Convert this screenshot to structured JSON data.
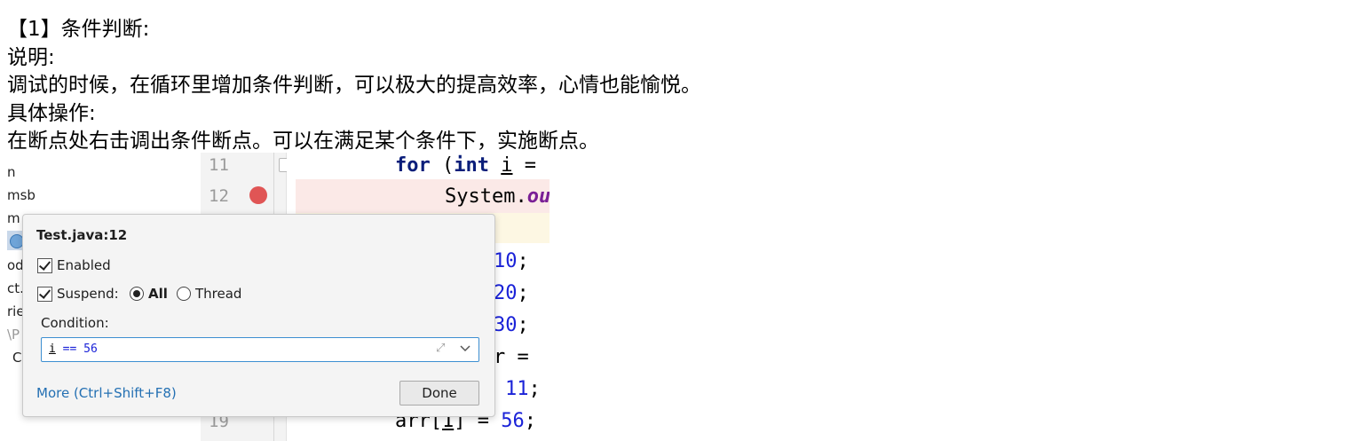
{
  "article": {
    "heading": "【1】条件判断:",
    "explain_label": "说明:",
    "explain_text": "调试的时候，在循环里增加条件判断，可以极大的提高效率，心情也能愉悦。",
    "steps_label": "具体操作:",
    "steps_text": "在断点处右击调出条件断点。可以在满足某个条件下，实施断点。"
  },
  "project_tree": {
    "items": [
      "n",
      "msb",
      "m",
      "od",
      "ct.i",
      "rie",
      "\\P",
      "C"
    ]
  },
  "gutter": {
    "line_numbers": [
      "11",
      "12",
      "19"
    ]
  },
  "code": {
    "line11": {
      "kw1": "for",
      "p1": " (",
      "kw2": "int",
      "sp": " ",
      "var": "i",
      "rest": " ="
    },
    "line12": {
      "pre": "System.",
      "ital": "ou"
    },
    "line_a": {
      "num": "10",
      "tail": ";"
    },
    "line_b": {
      "num": "20",
      "tail": ";"
    },
    "line_c": {
      "num": "30",
      "tail": ";"
    },
    "line_d": {
      "text": "r = "
    },
    "line_e": {
      "num": "11",
      "tail": ";"
    },
    "line19": {
      "pre": "arr[",
      "idx": "1",
      "mid": "] = ",
      "num": "56",
      "tail": ";"
    }
  },
  "popup": {
    "title": "Test.java:12",
    "enabled_label": "Enabled",
    "suspend_label": "Suspend:",
    "all_label": "All",
    "thread_label": "Thread",
    "condition_label": "Condition:",
    "condition_var": "i",
    "condition_rest": " == 56",
    "more_link": "More (Ctrl+Shift+F8)",
    "done_label": "Done",
    "enabled_checked": true,
    "suspend_checked": true,
    "suspend_mode": "All"
  },
  "colors": {
    "keyword": "#0a1e7a",
    "number": "#1a22d8",
    "breakpoint": "#e05555",
    "link": "#2470b3",
    "input_focus": "#3d8fd1"
  },
  "icons": [
    "breakpoint-icon",
    "fold-icon",
    "class-icon",
    "expand-icon",
    "chevron-down-icon"
  ]
}
